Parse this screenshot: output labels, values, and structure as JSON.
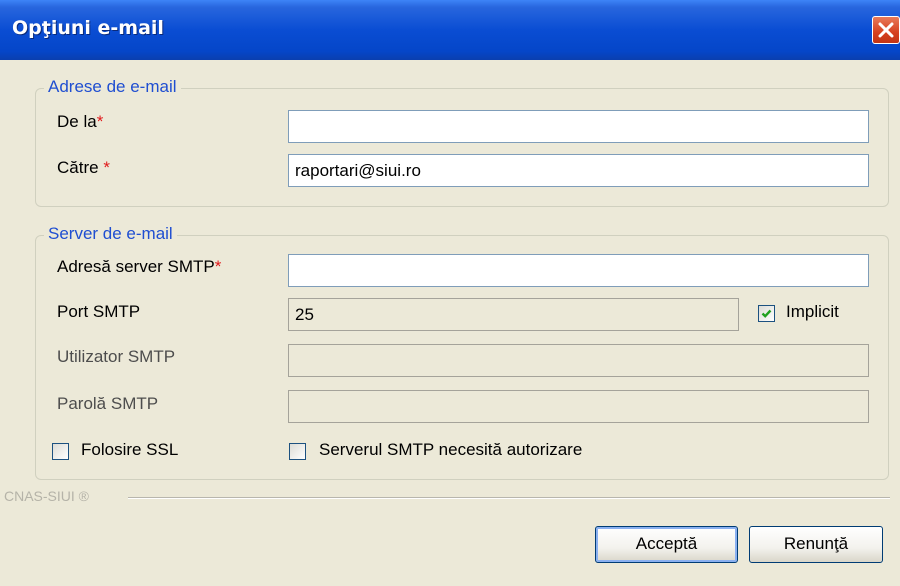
{
  "window": {
    "title": "Opţiuni e-mail"
  },
  "email_group": {
    "legend": "Adrese de e-mail",
    "from_label": "De la",
    "from_value": "",
    "to_label": "Către",
    "to_value": "raportari@siui.ro",
    "required_mark": "*"
  },
  "server_group": {
    "legend": "Server de e-mail",
    "smtp_address_label": "Adresă server SMTP",
    "smtp_address_value": "",
    "port_label": "Port SMTP",
    "port_value": "25",
    "default_label": "Implicit",
    "default_checked": true,
    "user_label": "Utilizator SMTP",
    "user_value": "",
    "password_label": "Parolă SMTP",
    "password_value": "",
    "ssl_label": "Folosire SSL",
    "ssl_checked": false,
    "auth_label": "Serverul SMTP necesită autorizare",
    "auth_checked": false
  },
  "footer": {
    "brand": "CNAS-SIUI ®",
    "accept_label": "Acceptă",
    "cancel_label": "Renunţă"
  },
  "colors": {
    "titlebar": "#0a4dd3",
    "legend_text": "#1f4ed1",
    "required": "#e0191b",
    "window_bg": "#ece9d8"
  },
  "icons": [
    "close-icon",
    "checkmark-icon"
  ]
}
